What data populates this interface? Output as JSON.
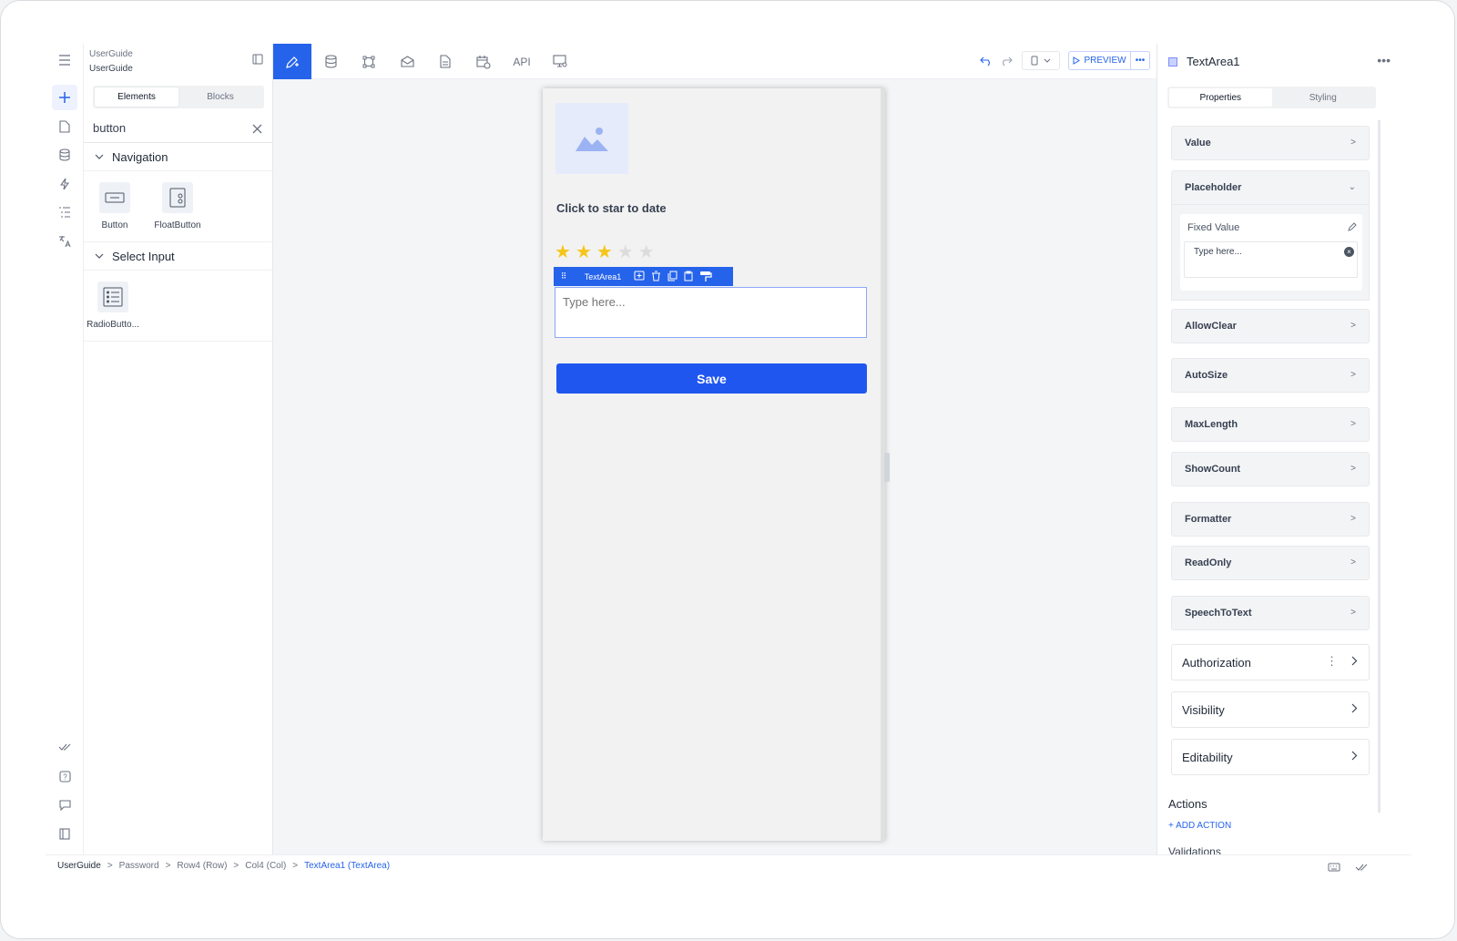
{
  "project": {
    "line1": "UserGuide",
    "line2": "UserGuide"
  },
  "left_panel": {
    "tabs": [
      "Elements",
      "Blocks"
    ],
    "active_tab": "Elements",
    "search_value": "button",
    "groups": [
      {
        "title": "Navigation",
        "items": [
          "Button",
          "FloatButton"
        ]
      },
      {
        "title": "Select Input",
        "items": [
          "RadioButto..."
        ]
      }
    ]
  },
  "toolbar": {
    "api_label": "API",
    "preview_label": "PREVIEW",
    "active_tool": "ui-builder"
  },
  "canvas": {
    "title": "Click to star to date",
    "rating": {
      "value": 3,
      "max": 5,
      "filled_color": "#f5c518",
      "empty_color": "#dcdcdc"
    },
    "selected_component": "TextArea1",
    "textarea_placeholder": "Type here...",
    "save_label": "Save"
  },
  "right_panel": {
    "component_name": "TextArea1",
    "tabs": [
      "Properties",
      "Styling"
    ],
    "active_tab": "Properties",
    "properties": [
      "Value",
      "Placeholder",
      "AllowClear",
      "AutoSize",
      "MaxLength",
      "ShowCount",
      "Formatter",
      "ReadOnly",
      "SpeechToText"
    ],
    "placeholder_section": {
      "label": "Fixed Value",
      "value": "Type here..."
    },
    "cards": [
      "Authorization",
      "Visibility",
      "Editability"
    ],
    "actions_title": "Actions",
    "add_action_label": "+ ADD ACTION",
    "validations_label": "Validations"
  },
  "breadcrumb": [
    "UserGuide",
    "Password",
    "Row4 (Row)",
    "Col4 (Col)",
    "TextArea1 (TextArea)"
  ],
  "colors": {
    "accent": "#2563eb",
    "save_button": "#2056f0"
  }
}
